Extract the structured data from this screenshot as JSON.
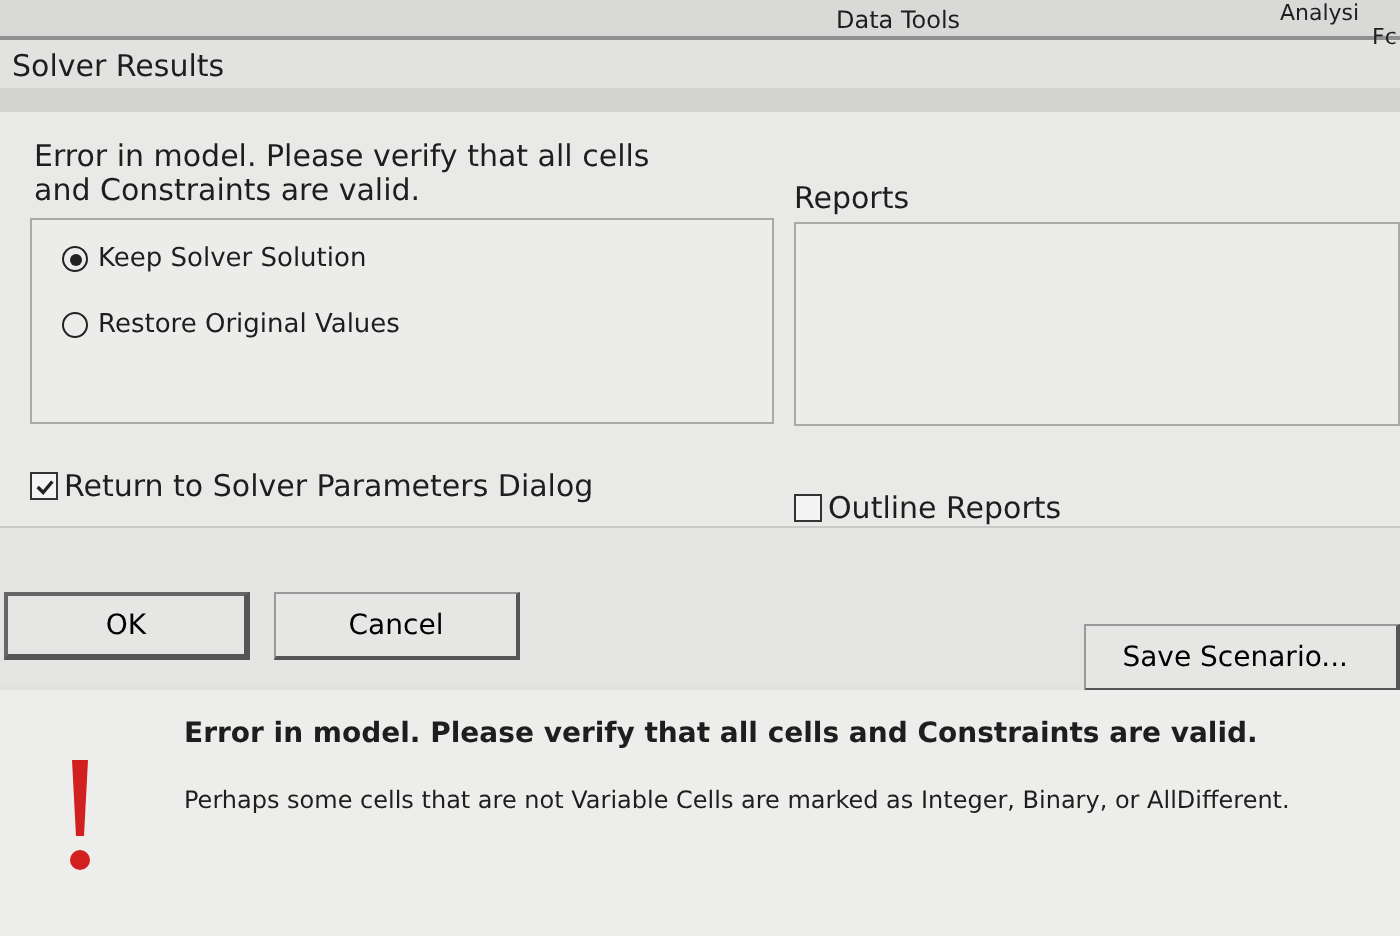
{
  "ribbon": {
    "groups": [
      "Data Tools",
      "Analysi",
      "Fc"
    ]
  },
  "window": {
    "title": "Solver Results"
  },
  "message": "Error in model.  Please verify that all cells and Constraints are valid.",
  "solution_options": [
    {
      "label": "Keep Solver Solution",
      "selected": true
    },
    {
      "label": "Restore Original Values",
      "selected": false
    }
  ],
  "reports": {
    "label": "Reports"
  },
  "checkboxes": [
    {
      "label": "Return to Solver Parameters Dialog",
      "checked": true
    },
    {
      "label": "Outline Reports",
      "checked": false
    }
  ],
  "buttons": [
    {
      "label": "OK",
      "kind": "default"
    },
    {
      "label": "Cancel",
      "kind": "normal"
    },
    {
      "label": "Save Scenario...",
      "kind": "right"
    }
  ],
  "details": {
    "heading": "Error in model.  Please verify that all cells and Constraints are valid.",
    "text": "Perhaps some cells that are not Variable Cells are marked as Integer, Binary, or AllDifferent."
  }
}
